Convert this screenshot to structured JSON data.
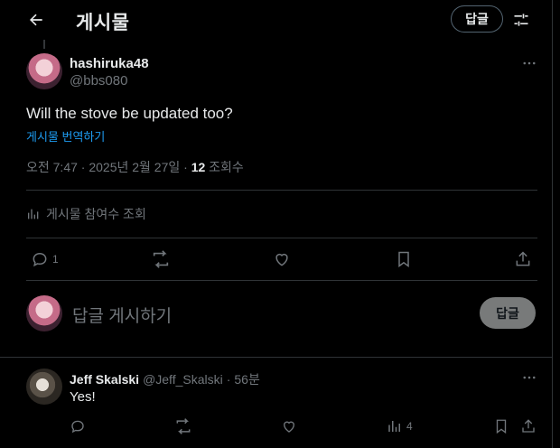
{
  "header": {
    "title": "게시물",
    "reply_button": "답글"
  },
  "post": {
    "author_name": "hashiruka48",
    "author_handle": "@bbs080",
    "text": "Will the stove be updated too?",
    "translate_link": "게시물 번역하기",
    "timestamp": "오전 7:47 · 2025년 2월 27일 · ",
    "views_count": "12",
    "views_label": " 조회수",
    "engagements_label": "게시물 참여수 조회",
    "actions": {
      "reply_count": "1",
      "repost_count": "",
      "like_count": ""
    }
  },
  "composer": {
    "placeholder": "답글 게시하기",
    "reply_button": "답글"
  },
  "reply": {
    "author_name": "Jeff Skalski",
    "author_handle": "@Jeff_Skalski",
    "dot": "·",
    "time": "56분",
    "text": "Yes!",
    "views_count": "4"
  },
  "colors": {
    "background": "#000000",
    "text": "#e7e9ea",
    "muted": "#71767b",
    "link": "#1d9bf0",
    "divider": "#2f3336"
  },
  "icons": [
    "back-arrow-icon",
    "settings-sliders-icon",
    "more-icon",
    "analytics-icon",
    "reply-icon",
    "repost-icon",
    "like-icon",
    "bookmark-icon",
    "share-icon"
  ]
}
